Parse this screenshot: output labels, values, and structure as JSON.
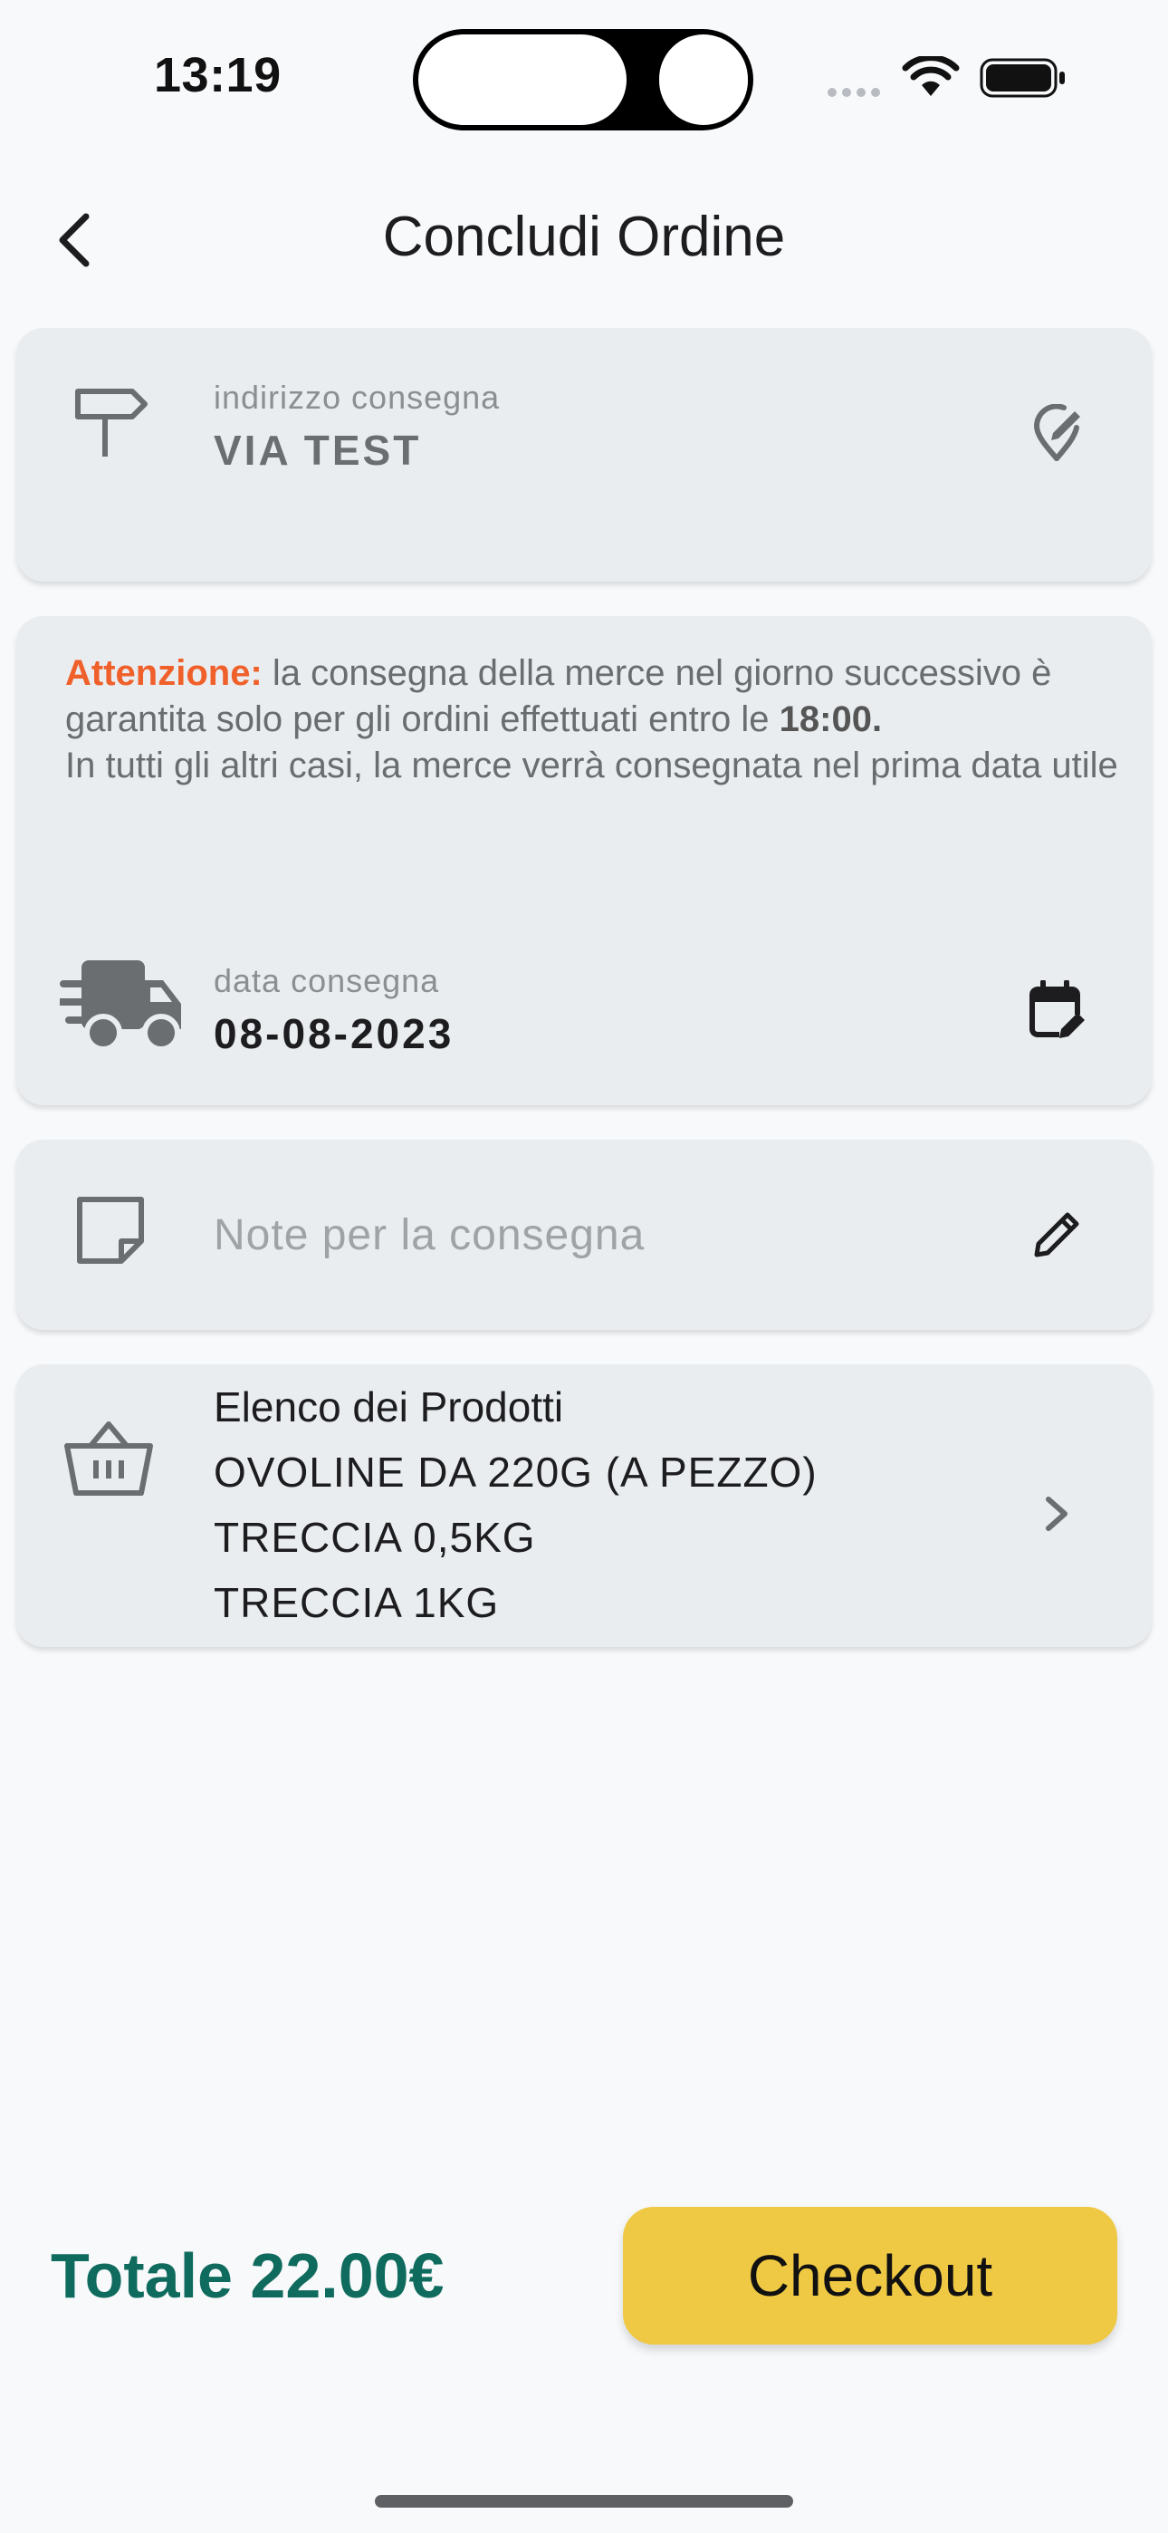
{
  "status_bar": {
    "time": "13:19"
  },
  "header": {
    "title": "Concludi Ordine"
  },
  "address": {
    "label": "indirizzo consegna",
    "value": "VIA TEST"
  },
  "delivery": {
    "notice_warn": "Attenzione:",
    "notice_part1": " la consegna della merce  nel giorno successivo è garantita solo per gli ordini effettuati entro le ",
    "notice_time": "18:00.",
    "notice_part2": "In tutti gli altri casi, la merce verrà consegnata nel prima data utile",
    "date_label": "data consegna",
    "date_value": "08-08-2023"
  },
  "notes": {
    "placeholder": "Note per la consegna"
  },
  "products": {
    "title": "Elenco dei Prodotti",
    "items": [
      "OVOLINE DA 220G (A PEZZO)",
      "TRECCIA 0,5KG",
      "TRECCIA 1KG"
    ]
  },
  "footer": {
    "total": "Totale 22.00€",
    "checkout_label": "Checkout"
  },
  "colors": {
    "accent_yellow": "#efc943",
    "total_green": "#0f6b5d",
    "warning_orange": "#f0602a",
    "card_bg": "#e9edef"
  },
  "icons": [
    "chevron-left-icon",
    "signpost-icon",
    "location-edit-icon",
    "truck-fast-icon",
    "calendar-edit-icon",
    "sticky-note-icon",
    "pencil-icon",
    "basket-icon",
    "chevron-right-icon",
    "wifi-icon",
    "battery-icon"
  ]
}
